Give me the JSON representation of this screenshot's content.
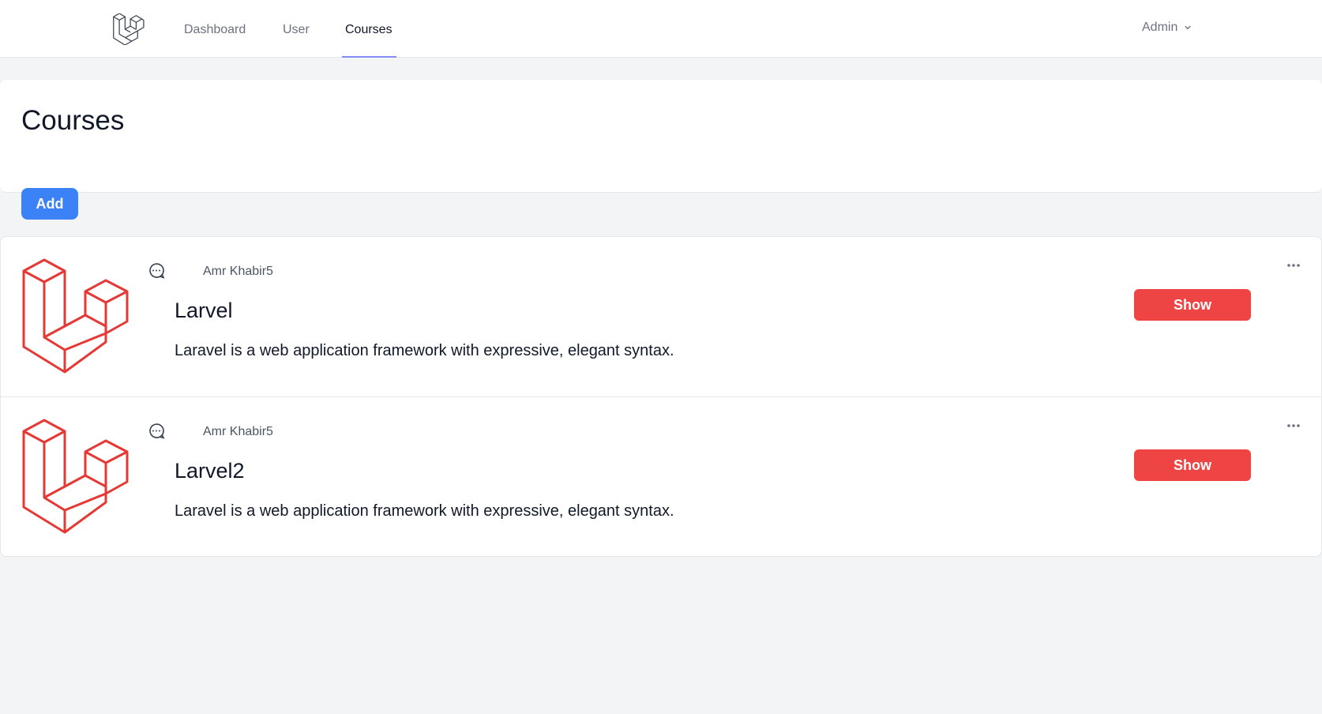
{
  "nav": {
    "links": [
      {
        "label": "Dashboard",
        "active": false
      },
      {
        "label": "User",
        "active": false
      },
      {
        "label": "Courses",
        "active": true
      }
    ],
    "user_menu": {
      "label": "Admin",
      "icon": "chevron-down-icon"
    },
    "logo_icon": "laravel-logo-icon"
  },
  "header": {
    "title": "Courses"
  },
  "toolbar": {
    "add_label": "Add"
  },
  "courses": [
    {
      "author": "Amr Khabir5",
      "title": "Larvel",
      "description": "Laravel is a web application framework with expressive, elegant syntax.",
      "show_label": "Show",
      "thumbnail": "laravel-logo-image"
    },
    {
      "author": "Amr Khabir5",
      "title": "Larvel2",
      "description": "Laravel is a web application framework with expressive, elegant syntax.",
      "show_label": "Show",
      "thumbnail": "laravel-logo-image"
    }
  ],
  "colors": {
    "accent_blue": "#3b82f6",
    "danger_red": "#ef4444",
    "laravel_red": "#e53935",
    "nav_underline": "#818cf8"
  }
}
